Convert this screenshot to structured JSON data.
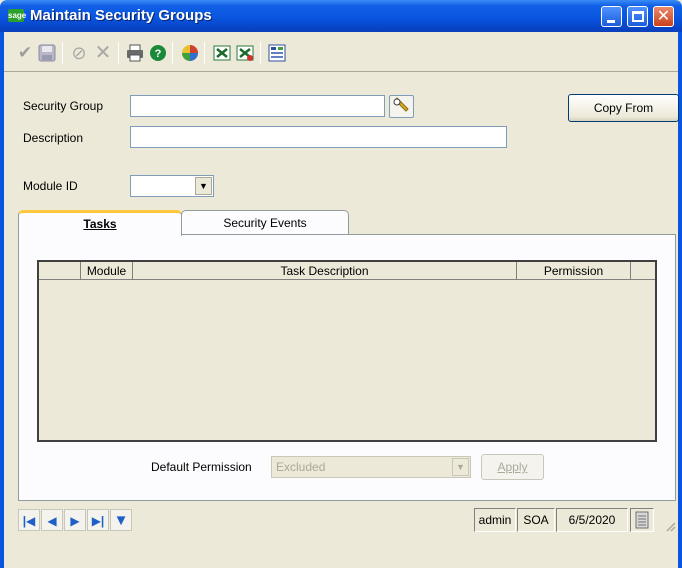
{
  "window": {
    "title": "Maintain Security Groups",
    "app_logo": "sage"
  },
  "toolbar": {
    "icons": [
      "accept-icon",
      "save-icon",
      "cancel-icon",
      "delete-icon",
      "print-icon",
      "help-icon",
      "color-wheel-icon",
      "export-icon",
      "import-icon",
      "settings-icon"
    ]
  },
  "form": {
    "security_group_label": "Security Group",
    "security_group_value": "",
    "description_label": "Description",
    "description_value": "",
    "module_id_label": "Module ID",
    "module_id_value": "",
    "copy_from_label": "Copy From"
  },
  "tabs": [
    {
      "label": "Tasks",
      "active": true
    },
    {
      "label": "Security Events",
      "active": false
    }
  ],
  "grid": {
    "columns": [
      "",
      "Module",
      "Task Description",
      "Permission"
    ],
    "rows": []
  },
  "default_permission": {
    "label": "Default Permission",
    "value": "Excluded",
    "apply_label": "Apply"
  },
  "status": {
    "user": "admin",
    "company": "SOA",
    "date": "6/5/2020"
  },
  "colors": {
    "titlebar": "#0a55e0",
    "window_bg": "#ece9d8",
    "tab_highlight": "#ffc83c"
  }
}
